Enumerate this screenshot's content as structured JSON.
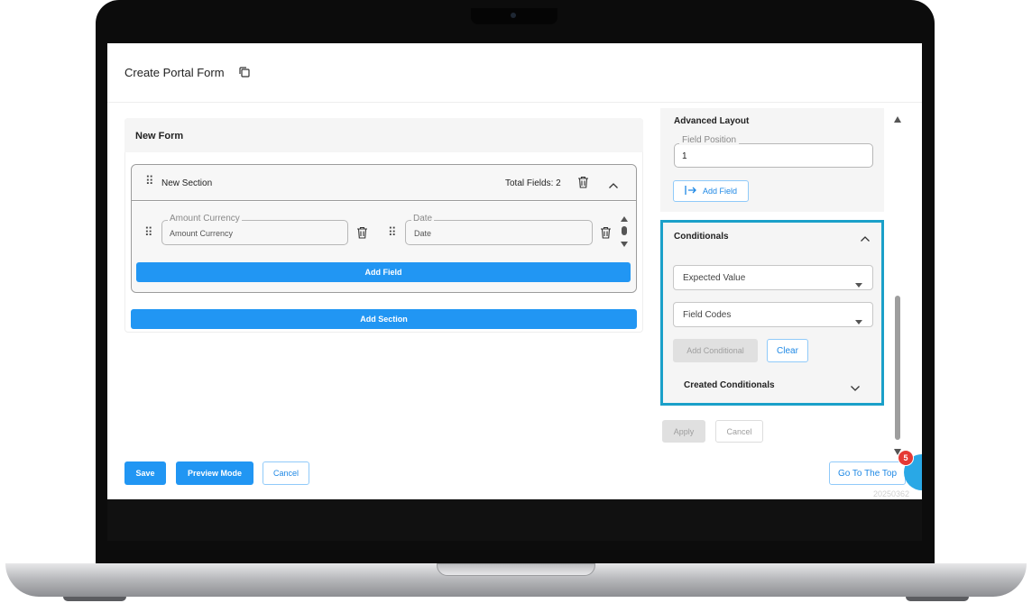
{
  "header": {
    "title": "Create Portal Form"
  },
  "form": {
    "name": "New Form",
    "section": {
      "name": "New Section",
      "total_fields": "Total Fields: 2",
      "fields": [
        {
          "label": "Amount Currency",
          "placeholder": "Amount Currency"
        },
        {
          "label": "Date",
          "placeholder": "Date"
        }
      ],
      "add_field_label": "Add Field"
    },
    "add_section_label": "Add Section"
  },
  "side": {
    "advanced_layout_title": "Advanced Layout",
    "field_position_label": "Field Position",
    "field_position_value": "1",
    "add_field_label": "Add Field",
    "conditionals": {
      "title": "Conditionals",
      "expected_value_placeholder": "Expected Value",
      "field_codes_placeholder": "Field Codes",
      "add_conditional_label": "Add Conditional",
      "clear_label": "Clear",
      "created_conditionals_label": "Created Conditionals"
    },
    "apply_label": "Apply",
    "cancel_label": "Cancel"
  },
  "footer": {
    "save_label": "Save",
    "preview_label": "Preview Mode",
    "cancel_label": "Cancel",
    "go_top_label": "Go To The Top",
    "notification_count": "5",
    "version_text": "20250362"
  },
  "colors": {
    "primary": "#2196f3",
    "highlight_border": "#1aa0c9",
    "badge": "#e53935"
  }
}
